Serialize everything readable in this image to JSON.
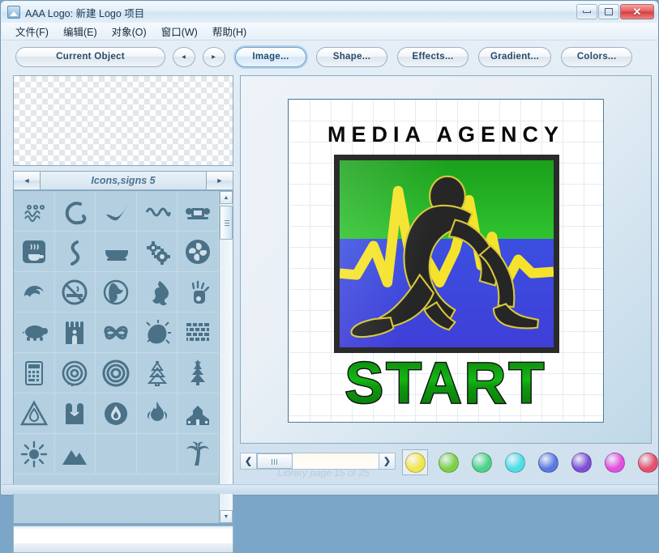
{
  "window": {
    "title": "AAA Logo: 新建 Logo 项目",
    "app_icon": "app-logo-icon",
    "controls": {
      "minimize": "–",
      "maximize": "□",
      "close": "✕"
    }
  },
  "menu": {
    "items": [
      {
        "label": "文件(F)"
      },
      {
        "label": "编辑(E)"
      },
      {
        "label": "对象(O)"
      },
      {
        "label": "窗口(W)"
      },
      {
        "label": "帮助(H)"
      }
    ]
  },
  "toolbar": {
    "current_object": "Current Object",
    "prev_arrow": "◄",
    "next_arrow": "►",
    "tabs": [
      {
        "label": "Image...",
        "active": true
      },
      {
        "label": "Shape...",
        "active": false
      },
      {
        "label": "Effects...",
        "active": false
      },
      {
        "label": "Gradient...",
        "active": false
      },
      {
        "label": "Colors...",
        "active": false
      }
    ]
  },
  "library": {
    "prev": "◄",
    "next": "►",
    "name": "Icons,signs 5",
    "page_status": "Library page  15 of 25",
    "icons": [
      "waves-triple-icon",
      "spiral-loop-icon",
      "checkmark-swoosh-icon",
      "squiggle-wave-icon",
      "telephone-icon",
      "coffee-cup-icon",
      "s-curve-icon",
      "bowl-icon",
      "gears-icon",
      "celtic-knot-icon",
      "wave-curl-icon",
      "no-smoking-icon",
      "globe-icon",
      "globe-americas-icon",
      "handprint-icon",
      "turtle-icon",
      "castle-icon",
      "butterfly-icon",
      "ink-blob-icon",
      "brick-wall-icon",
      "calculator-icon",
      "spiral-dotted-icon",
      "spiral-icon",
      "christmas-tree-outline-icon",
      "pine-tree-icon",
      "fire-warning-icon",
      "handshake-icon",
      "flame-circle-icon",
      "flame-icon",
      "church-icon",
      "sun-icon",
      "mountain-icon",
      "blank-icon",
      "blank-icon",
      "palm-tree-icon"
    ]
  },
  "canvas": {
    "media_title": "MEDIA AGENCY",
    "start_text": "START",
    "colors": {
      "title_color": "#0a0a0a",
      "bg_green": "#2fc32f",
      "bg_blue": "#3f3fd8",
      "bolt_yellow": "#f5e32b",
      "runner_black": "#2b2b2b",
      "start_green": "#12a012",
      "frame_black": "#2b2b2b"
    }
  },
  "scrollbars": {
    "h_left": "❮",
    "h_right": "❯",
    "v_up": "▲",
    "v_down": "▼"
  },
  "swatches": [
    {
      "name": "yellow",
      "hex": "#f0e64b",
      "selected": true
    },
    {
      "name": "yellow-green",
      "hex": "#7ed048",
      "selected": false
    },
    {
      "name": "green",
      "hex": "#4cd389",
      "selected": false
    },
    {
      "name": "cyan",
      "hex": "#4fdde6",
      "selected": false
    },
    {
      "name": "blue",
      "hex": "#5a79dd",
      "selected": false
    },
    {
      "name": "purple",
      "hex": "#7e4fd6",
      "selected": false
    },
    {
      "name": "magenta",
      "hex": "#e250dd",
      "selected": false
    },
    {
      "name": "crimson",
      "hex": "#e6506f",
      "selected": false
    },
    {
      "name": "orange",
      "hex": "#ef8b3c",
      "selected": false
    }
  ]
}
